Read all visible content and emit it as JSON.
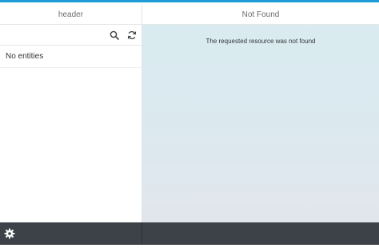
{
  "master": {
    "header_title": "header",
    "search_icon": "search-icon",
    "refresh_icon": "refresh-icon",
    "empty_text": "No entities"
  },
  "detail": {
    "header_title": "Not Found",
    "message": "The requested resource was not found"
  },
  "footer": {
    "settings_icon": "gear-icon"
  },
  "colors": {
    "accent": "#1f9bd8",
    "footer_bg": "#3c4247",
    "detail_bg_top": "#d9ecf1",
    "detail_bg_bottom": "#e1e6ec"
  }
}
